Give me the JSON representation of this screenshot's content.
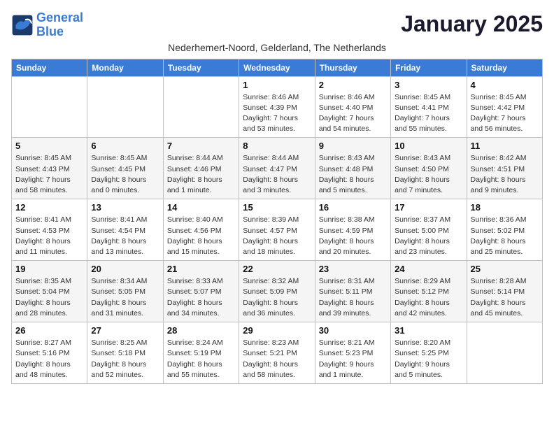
{
  "logo": {
    "line1": "General",
    "line2": "Blue"
  },
  "title": "January 2025",
  "subtitle": "Nederhemert-Noord, Gelderland, The Netherlands",
  "days_of_week": [
    "Sunday",
    "Monday",
    "Tuesday",
    "Wednesday",
    "Thursday",
    "Friday",
    "Saturday"
  ],
  "weeks": [
    [
      {
        "day": "",
        "info": ""
      },
      {
        "day": "",
        "info": ""
      },
      {
        "day": "",
        "info": ""
      },
      {
        "day": "1",
        "info": "Sunrise: 8:46 AM\nSunset: 4:39 PM\nDaylight: 7 hours\nand 53 minutes."
      },
      {
        "day": "2",
        "info": "Sunrise: 8:46 AM\nSunset: 4:40 PM\nDaylight: 7 hours\nand 54 minutes."
      },
      {
        "day": "3",
        "info": "Sunrise: 8:45 AM\nSunset: 4:41 PM\nDaylight: 7 hours\nand 55 minutes."
      },
      {
        "day": "4",
        "info": "Sunrise: 8:45 AM\nSunset: 4:42 PM\nDaylight: 7 hours\nand 56 minutes."
      }
    ],
    [
      {
        "day": "5",
        "info": "Sunrise: 8:45 AM\nSunset: 4:43 PM\nDaylight: 7 hours\nand 58 minutes."
      },
      {
        "day": "6",
        "info": "Sunrise: 8:45 AM\nSunset: 4:45 PM\nDaylight: 8 hours\nand 0 minutes."
      },
      {
        "day": "7",
        "info": "Sunrise: 8:44 AM\nSunset: 4:46 PM\nDaylight: 8 hours\nand 1 minute."
      },
      {
        "day": "8",
        "info": "Sunrise: 8:44 AM\nSunset: 4:47 PM\nDaylight: 8 hours\nand 3 minutes."
      },
      {
        "day": "9",
        "info": "Sunrise: 8:43 AM\nSunset: 4:48 PM\nDaylight: 8 hours\nand 5 minutes."
      },
      {
        "day": "10",
        "info": "Sunrise: 8:43 AM\nSunset: 4:50 PM\nDaylight: 8 hours\nand 7 minutes."
      },
      {
        "day": "11",
        "info": "Sunrise: 8:42 AM\nSunset: 4:51 PM\nDaylight: 8 hours\nand 9 minutes."
      }
    ],
    [
      {
        "day": "12",
        "info": "Sunrise: 8:41 AM\nSunset: 4:53 PM\nDaylight: 8 hours\nand 11 minutes."
      },
      {
        "day": "13",
        "info": "Sunrise: 8:41 AM\nSunset: 4:54 PM\nDaylight: 8 hours\nand 13 minutes."
      },
      {
        "day": "14",
        "info": "Sunrise: 8:40 AM\nSunset: 4:56 PM\nDaylight: 8 hours\nand 15 minutes."
      },
      {
        "day": "15",
        "info": "Sunrise: 8:39 AM\nSunset: 4:57 PM\nDaylight: 8 hours\nand 18 minutes."
      },
      {
        "day": "16",
        "info": "Sunrise: 8:38 AM\nSunset: 4:59 PM\nDaylight: 8 hours\nand 20 minutes."
      },
      {
        "day": "17",
        "info": "Sunrise: 8:37 AM\nSunset: 5:00 PM\nDaylight: 8 hours\nand 23 minutes."
      },
      {
        "day": "18",
        "info": "Sunrise: 8:36 AM\nSunset: 5:02 PM\nDaylight: 8 hours\nand 25 minutes."
      }
    ],
    [
      {
        "day": "19",
        "info": "Sunrise: 8:35 AM\nSunset: 5:04 PM\nDaylight: 8 hours\nand 28 minutes."
      },
      {
        "day": "20",
        "info": "Sunrise: 8:34 AM\nSunset: 5:05 PM\nDaylight: 8 hours\nand 31 minutes."
      },
      {
        "day": "21",
        "info": "Sunrise: 8:33 AM\nSunset: 5:07 PM\nDaylight: 8 hours\nand 34 minutes."
      },
      {
        "day": "22",
        "info": "Sunrise: 8:32 AM\nSunset: 5:09 PM\nDaylight: 8 hours\nand 36 minutes."
      },
      {
        "day": "23",
        "info": "Sunrise: 8:31 AM\nSunset: 5:11 PM\nDaylight: 8 hours\nand 39 minutes."
      },
      {
        "day": "24",
        "info": "Sunrise: 8:29 AM\nSunset: 5:12 PM\nDaylight: 8 hours\nand 42 minutes."
      },
      {
        "day": "25",
        "info": "Sunrise: 8:28 AM\nSunset: 5:14 PM\nDaylight: 8 hours\nand 45 minutes."
      }
    ],
    [
      {
        "day": "26",
        "info": "Sunrise: 8:27 AM\nSunset: 5:16 PM\nDaylight: 8 hours\nand 48 minutes."
      },
      {
        "day": "27",
        "info": "Sunrise: 8:25 AM\nSunset: 5:18 PM\nDaylight: 8 hours\nand 52 minutes."
      },
      {
        "day": "28",
        "info": "Sunrise: 8:24 AM\nSunset: 5:19 PM\nDaylight: 8 hours\nand 55 minutes."
      },
      {
        "day": "29",
        "info": "Sunrise: 8:23 AM\nSunset: 5:21 PM\nDaylight: 8 hours\nand 58 minutes."
      },
      {
        "day": "30",
        "info": "Sunrise: 8:21 AM\nSunset: 5:23 PM\nDaylight: 9 hours\nand 1 minute."
      },
      {
        "day": "31",
        "info": "Sunrise: 8:20 AM\nSunset: 5:25 PM\nDaylight: 9 hours\nand 5 minutes."
      },
      {
        "day": "",
        "info": ""
      }
    ]
  ]
}
